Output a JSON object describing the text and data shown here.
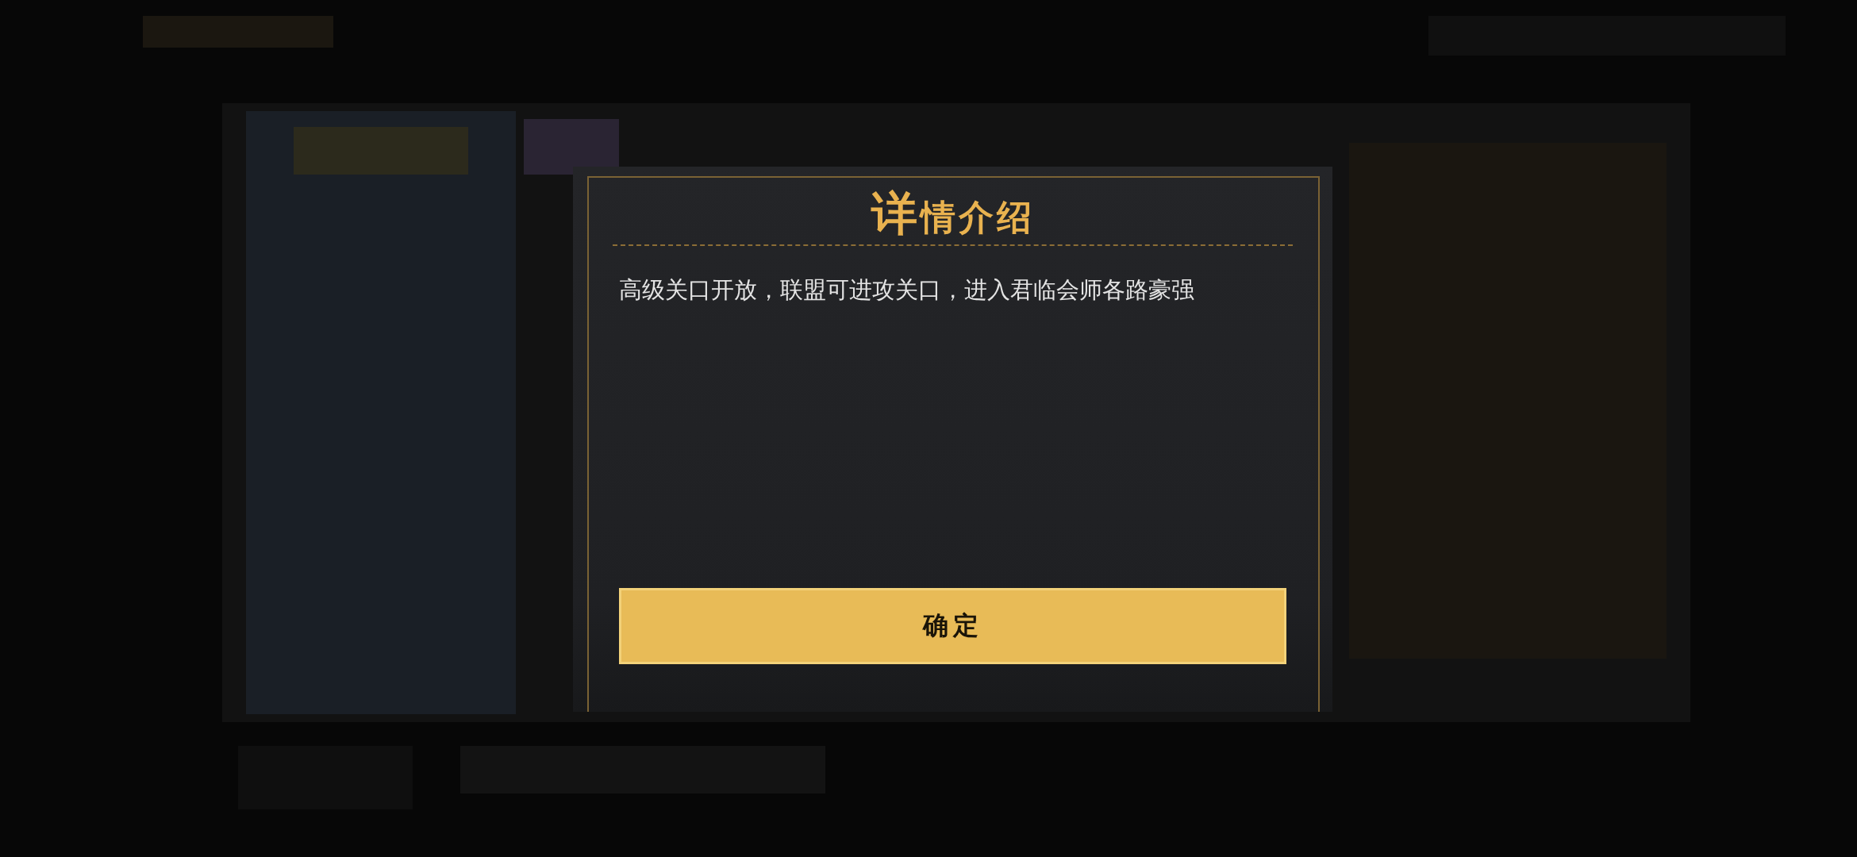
{
  "dialog": {
    "title": "详情介绍",
    "message": "高级关口开放，联盟可进攻关口，进入君临会师各路豪强",
    "confirm_button": "确定"
  }
}
